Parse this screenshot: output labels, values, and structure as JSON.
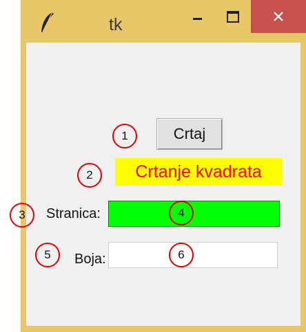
{
  "window": {
    "title": "tk",
    "controls": {
      "minimize_icon": "minimize-icon",
      "maximize_icon": "maximize-icon",
      "close_icon": "close-icon"
    },
    "colors": {
      "frame": "#e8c768",
      "close": "#c8504f",
      "client": "#f0f0f0"
    }
  },
  "form": {
    "button_label": "Crtaj",
    "heading": "Crtanje kvadrata",
    "heading_colors": {
      "background": "#ffff00",
      "text": "#ff0000"
    },
    "stranica_label": "Stranica:",
    "stranica_value": "",
    "stranica_bg": "#00ff00",
    "boja_label": "Boja:",
    "boja_value": ""
  },
  "markers": [
    "1",
    "2",
    "3",
    "4",
    "5",
    "6"
  ]
}
